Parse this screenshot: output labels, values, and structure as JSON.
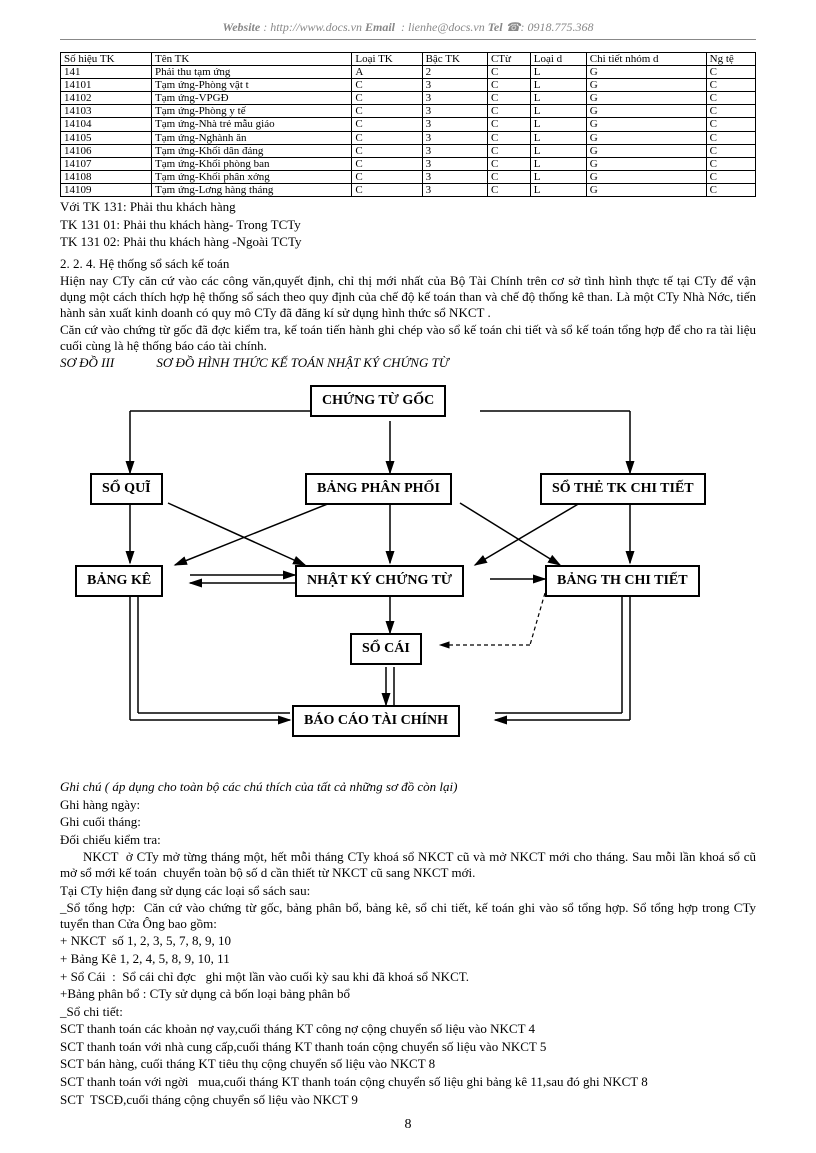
{
  "header": {
    "website_label": "Website",
    "website_url": "http://www.docs.vn",
    "email_label": "Email",
    "email_addr": "lienhe@docs.vn",
    "tel_label": "Tel",
    "tel_icon": "☎",
    "tel_no": "0918.775.368"
  },
  "table": {
    "headers": [
      "Số hiệu TK",
      "Tên TK",
      "Loại TK",
      "Bậc TK",
      "CTừ",
      "Loại d",
      "Chi tiết nhóm d",
      "Ng tệ"
    ],
    "rows": [
      [
        "141",
        "Phải thu tạm ứng",
        "A",
        "2",
        "C",
        "L",
        "G",
        "C"
      ],
      [
        "14101",
        "Tạm ứng-Phòng vật t",
        "C",
        "3",
        "C",
        "L",
        "G",
        "C"
      ],
      [
        "14102",
        "Tạm ứng-VPGĐ",
        "C",
        "3",
        "C",
        "L",
        "G",
        "C"
      ],
      [
        "14103",
        "Tạm ứng-Phòng y tế",
        "C",
        "3",
        "C",
        "L",
        "G",
        "C"
      ],
      [
        "14104",
        "Tạm ứng-Nhà trẻ mẫu giáo",
        "C",
        "3",
        "C",
        "L",
        "G",
        "C"
      ],
      [
        "14105",
        "Tạm ứng-Nghành ăn",
        "C",
        "3",
        "C",
        "L",
        "G",
        "C"
      ],
      [
        "14106",
        "Tạm ứng-Khối dân đảng",
        "C",
        "3",
        "C",
        "L",
        "G",
        "C"
      ],
      [
        "14107",
        "Tạm ứng-Khối phòng ban",
        "C",
        "3",
        "C",
        "L",
        "G",
        "C"
      ],
      [
        "14108",
        "Tạm ứng-Khối phân xởng",
        "C",
        "3",
        "C",
        "L",
        "G",
        "C"
      ],
      [
        "14109",
        "Tạm ứng-Lơng   hàng tháng",
        "C",
        "3",
        "C",
        "L",
        "G",
        "C"
      ]
    ]
  },
  "notes": [
    "Với TK  131: Phải thu khách hàng",
    "TK  131 01: Phải thu khách hàng- Trong TCTy",
    "TK  131 02: Phải thu khách hàng -Ngoài TCTy"
  ],
  "section224": "2. 2. 4. Hệ thống sổ sách  kế toán",
  "body1": "Hiện nay CTy căn cứ vào các công văn,quyết định, chỉ thị mới nhất của Bộ Tài Chính trên cơ sở tình hình thực tế tại CTy để vận dụng một cách thích hợp hệ thống sổ sách theo quy định của chế độ kế toán than và chế độ thống kê than. Là một CTy  Nhà Nớc,    tiến hành sản xuất kinh doanh có quy mô CTy đã đăng kí sử dụng hình thức sổ NKCT .",
  "body2": "Căn cứ vào chứng từ gốc đã đợc   kiểm tra, kế toán tiến hành ghi chép vào sổ kế toán chi tiết và sổ kế toán tổng hợp để cho ra tài liệu cuối cùng là hệ thống báo cáo tài chính.",
  "sodo_label": "SƠ ĐỒ III",
  "sodo_title": "SƠ ĐỒ HÌNH THỨC KẾ TOÁN NHẬT KÝ CHỨNG TỪ",
  "boxes": {
    "chungtugoc": "CHỨNG TỪ GỐC",
    "soqui": "SỔ QUĨ",
    "bangphanphoi": "BẢNG PHÂN PHỐI",
    "sothetk": "SỔ THẺ TK CHI TIẾT",
    "bangke": "BẢNG KÊ",
    "nhatky": "NHẬT KÝ CHỨNG TỪ",
    "bangth": "BẢNG TH CHI TIẾT",
    "socai": "SỔ CÁI",
    "baocao": "BÁO CÁO TÀI CHÍNH"
  },
  "ghichu_title": "Ghi chú ( áp dụng cho toàn bộ các  chú thích của tất cả  những sơ đồ còn lại)",
  "ghichu_lines": [
    "Ghi hàng ngày:",
    "Ghi cuối tháng:",
    "Đối chiếu kiểm tra:"
  ],
  "body3": [
    "      NKCT  ở CTy mở từng tháng một, hết mỗi tháng CTy khoá sổ NKCT cũ và mở NKCT mới cho tháng. Sau mỗi lần khoá sổ cũ mở sổ mới kế toán  chuyển toàn bộ số d cần thiết từ NKCT cũ sang NKCT mới.",
    "Tại CTy hiện đang sử dụng các loại sổ sách sau:",
    "_Sổ tổng hợp:  Căn cứ vào chứng từ gốc, bảng phân bổ, bảng kê, sổ chi tiết, kế toán ghi vào sổ tổng hợp. Sổ tổng hợp trong CTy tuyển than Cửa Ông bao gồm:",
    "+ NKCT  số 1, 2, 3, 5, 7, 8, 9, 10",
    "+ Bảng Kê 1, 2, 4, 5, 8, 9, 10, 11",
    "+ Sổ Cái  :  Sổ cái chỉ đợc   ghi một lần vào cuối kỳ sau khi đã khoá sổ NKCT.",
    "+Bảng phân bổ : CTy sử dụng cả bốn loại bảng phân bổ",
    "_Sổ chi tiết:",
    "SCT thanh toán các khoản nợ vay,cuối tháng KT công nợ cộng chuyển số liệu vào NKCT 4",
    "SCT thanh toán với nhà cung cấp,cuối tháng KT thanh toán cộng chuyển số liệu vào NKCT 5",
    "SCT bán hàng, cuối tháng KT tiêu thụ cộng chuyển số liệu vào NKCT 8",
    "SCT thanh toán với ngời   mua,cuối tháng KT thanh toán cộng chuyển số liệu ghi bảng kê 11,sau đó ghi NKCT 8",
    "SCT  TSCĐ,cuối tháng cộng chuyển số liệu vào NKCT 9"
  ],
  "page_no": "8"
}
